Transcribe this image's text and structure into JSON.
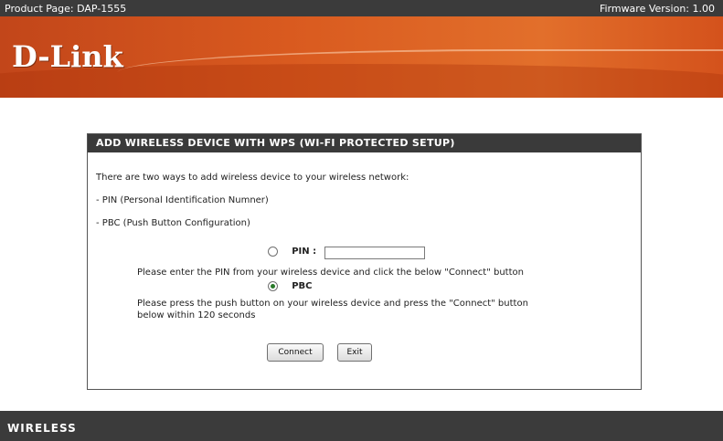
{
  "topbar": {
    "product": "Product Page: DAP-1555",
    "firmware": "Firmware Version: 1.00"
  },
  "brand": {
    "logo": "D-Link"
  },
  "panel": {
    "title": "ADD WIRELESS DEVICE WITH WPS (WI-FI PROTECTED SETUP)",
    "intro": "There are two ways to add wireless device to your wireless network:",
    "option1": "- PIN (Personal Identification Numner)",
    "option2": "- PBC (Push Button Configuration)",
    "pin": {
      "label": "PIN :",
      "value": "",
      "selected": false,
      "help": "Please enter the PIN from your wireless device and click the below \"Connect\" button"
    },
    "pbc": {
      "label": "PBC",
      "selected": true,
      "help_line1": "Please press the push button on your wireless device and press the \"Connect\" button",
      "help_line2": "below within 120 seconds"
    },
    "buttons": {
      "connect": "Connect",
      "exit": "Exit"
    }
  },
  "footer": {
    "section": "WIRELESS"
  },
  "colors": {
    "bar": "#3b3b3b",
    "banner": "#d95a1f",
    "radio_selected": "#2a7a2a"
  }
}
